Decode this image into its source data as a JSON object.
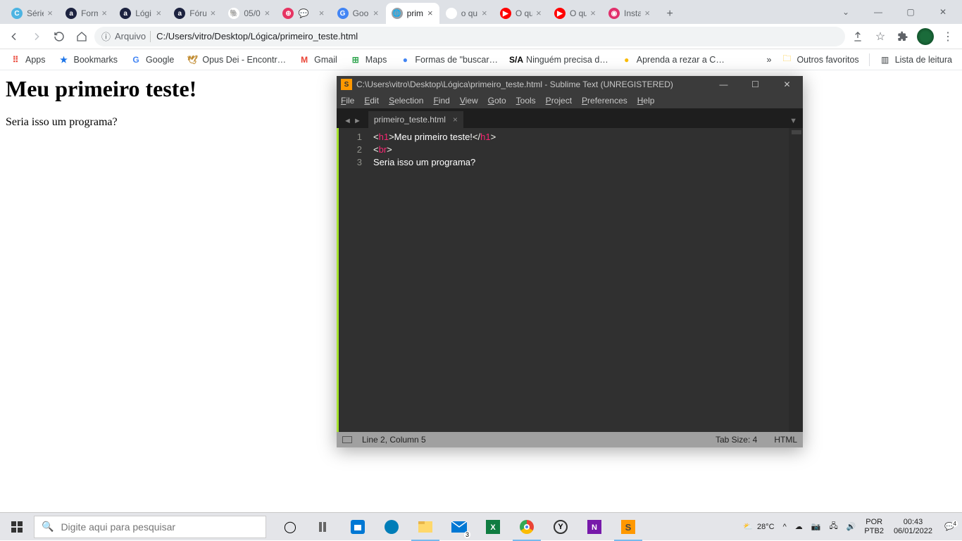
{
  "chrome": {
    "tabs": [
      {
        "title": "Série",
        "fav": "C",
        "favbg": "#4db4e2"
      },
      {
        "title": "Form",
        "fav": "a",
        "favbg": "#1d2340"
      },
      {
        "title": "Lógi",
        "fav": "a",
        "favbg": "#1d2340"
      },
      {
        "title": "Fóru",
        "fav": "a",
        "favbg": "#1d2340"
      },
      {
        "title": "05/0",
        "fav": "🐘",
        "favbg": "#fff"
      },
      {
        "title": "💬",
        "fav": "⊕",
        "favbg": "#e63462"
      },
      {
        "title": "Goo",
        "fav": "G",
        "favbg": "#4285f4"
      },
      {
        "title": "prim",
        "fav": "🌐",
        "favbg": "#9aa0a6",
        "active": true
      },
      {
        "title": "o qu",
        "fav": "G",
        "favbg": "#fff"
      },
      {
        "title": "O qu",
        "fav": "▶",
        "favbg": "#ff0000"
      },
      {
        "title": "O qu",
        "fav": "▶",
        "favbg": "#ff0000"
      },
      {
        "title": "Insta",
        "fav": "◉",
        "favbg": "#e1306c"
      }
    ],
    "addr_label": "Arquivo",
    "url": "C:/Users/vitro/Desktop/Lógica/primeiro_teste.html",
    "bookmarks": [
      {
        "label": "Apps",
        "icon": "⠿",
        "color": "#ea4335"
      },
      {
        "label": "Bookmarks",
        "icon": "★",
        "color": "#1a73e8"
      },
      {
        "label": "Google",
        "icon": "G",
        "color": "#4285f4"
      },
      {
        "label": "Opus Dei - Encontr…",
        "icon": "🕊",
        "color": "#c08a2e"
      },
      {
        "label": "Gmail",
        "icon": "M",
        "color": "#ea4335"
      },
      {
        "label": "Maps",
        "icon": "⊞",
        "color": "#34a853"
      },
      {
        "label": "Formas de \"buscar…",
        "icon": "●",
        "color": "#4285f4"
      },
      {
        "label": "Ninguém precisa d…",
        "icon": "S/A",
        "color": "#000"
      },
      {
        "label": "Aprenda a rezar a C…",
        "icon": "●",
        "color": "#fbbc04"
      }
    ],
    "bm_overflow": "»",
    "bm_other": "Outros favoritos",
    "bm_readlist": "Lista de leitura"
  },
  "page": {
    "h1": "Meu primeiro teste!",
    "p": "Seria isso um programa?"
  },
  "sublime": {
    "title": "C:\\Users\\vitro\\Desktop\\Lógica\\primeiro_teste.html - Sublime Text (UNREGISTERED)",
    "menus": [
      "File",
      "Edit",
      "Selection",
      "Find",
      "View",
      "Goto",
      "Tools",
      "Project",
      "Preferences",
      "Help"
    ],
    "tab": "primeiro_teste.html",
    "lines": [
      {
        "n": "1",
        "html": "<span class='pct'>&lt;</span><span class='tag-br'>h1</span><span class='pct'>&gt;</span><span class='tag-txt'>Meu primeiro teste!</span><span class='pct'>&lt;/</span><span class='tag-br'>h1</span><span class='pct'>&gt;</span>"
      },
      {
        "n": "2",
        "html": "<span class='pct'>&lt;</span><span class='tag-br'>br</span><span class='pct'>&gt;</span>"
      },
      {
        "n": "3",
        "html": "<span class='tag-txt'>Seria isso um programa?</span>"
      }
    ],
    "status_left": "Line 2, Column 5",
    "status_tab": "Tab Size: 4",
    "status_lang": "HTML"
  },
  "taskbar": {
    "search_placeholder": "Digite aqui para pesquisar",
    "weather": "28°C",
    "lang1": "POR",
    "lang2": "PTB2",
    "time": "00:43",
    "date": "06/01/2022",
    "notif_count": "4"
  }
}
